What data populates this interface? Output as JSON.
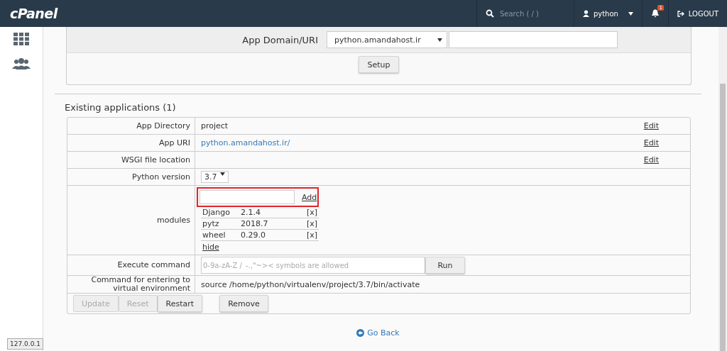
{
  "navbar": {
    "logo": "cPanel",
    "search": {
      "placeholder": "Search ( / )"
    },
    "user": "python",
    "notifications": "1",
    "logout": "LOGOUT"
  },
  "setup_panel": {
    "domain_label": "App Domain/URI",
    "domain_value": "python.amandahost.ir",
    "setup_button": "Setup"
  },
  "existing": {
    "title": "Existing applications (1)",
    "rows": [
      {
        "kind": "text",
        "label": "App Directory",
        "value": "project",
        "edit": "Edit"
      },
      {
        "kind": "link",
        "label": "App URI",
        "value": "python.amandahost.ir/",
        "edit": "Edit"
      },
      {
        "kind": "text",
        "label": "WSGI file location",
        "edit": "Edit"
      },
      {
        "kind": "select",
        "label": "Python version",
        "value": "3.7"
      },
      {
        "kind": "modules",
        "label": "modules",
        "add": "Add",
        "highlighted": true,
        "modules": [
          {
            "name": "Django",
            "version": "2.1.4",
            "remove": "[x]"
          },
          {
            "name": "pytz",
            "version": "2018.7",
            "remove": "[x]"
          },
          {
            "name": "wheel",
            "version": "0.29.0",
            "remove": "[x]"
          }
        ],
        "hide": "hide"
      },
      {
        "kind": "command",
        "label": "Execute command",
        "placeholder": "0-9a-zA-Z /_-.,\"~>< symbols are allowed",
        "run": "Run"
      },
      {
        "kind": "text",
        "label": "Command for entering to virtual environment",
        "value": "source /home/python/virtualenv/project/3.7/bin/activate"
      }
    ],
    "buttons": [
      {
        "label": "Update",
        "disabled": true
      },
      {
        "label": "Reset",
        "disabled": true
      },
      {
        "label": "Restart",
        "disabled": false
      },
      {
        "label": "Remove",
        "disabled": false
      }
    ]
  },
  "go_back": "Go Back",
  "status_tip": "127.0.0.1"
}
